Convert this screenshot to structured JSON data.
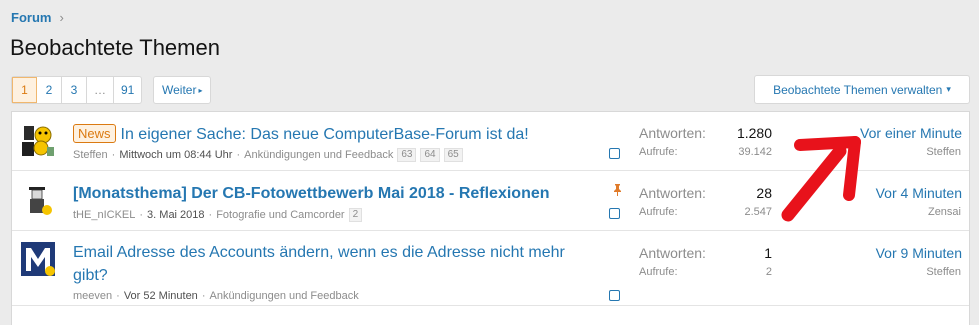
{
  "breadcrumb": {
    "label": "Forum",
    "separator": "›"
  },
  "page_title": "Beobachtete Themen",
  "pagination": {
    "pages": [
      "1",
      "2",
      "3",
      "…",
      "91"
    ],
    "current": "1",
    "next_label": "Weiter",
    "next_icon": "▸"
  },
  "manage_button": {
    "label": "Beobachtete Themen verwalten",
    "icon": "▾"
  },
  "threads": [
    {
      "badge": "News",
      "title": "In eigener Sache: Das neue ComputerBase-Forum ist da!",
      "author": "Steffen",
      "date": "Mittwoch um 08:44 Uhr",
      "forum": "Ankündigungen und Feedback",
      "pages": [
        "63",
        "64",
        "65"
      ],
      "replies_label": "Antworten:",
      "replies": "1.280",
      "views_label": "Aufrufe:",
      "views": "39.142",
      "last_time": "Vor einer Minute",
      "last_user": "Steffen"
    },
    {
      "title": "[Monatsthema] Der CB-Fotowettbewerb Mai 2018 - Reflexionen",
      "author": "tHE_nICKEL",
      "date": "3. Mai 2018",
      "forum": "Fotografie und Camcorder",
      "pages": [
        "2"
      ],
      "replies_label": "Antworten:",
      "replies": "28",
      "views_label": "Aufrufe:",
      "views": "2.547",
      "last_time": "Vor 4 Minuten",
      "last_user": "Zensai"
    },
    {
      "title_line1": "Email Adresse des Accounts ändern, wenn es die Adresse nicht mehr",
      "title_line2": "gibt?",
      "author": "meeven",
      "date": "Vor 52 Minuten",
      "forum": "Ankündigungen und Feedback",
      "replies_label": "Antworten:",
      "replies": "1",
      "views_label": "Aufrufe:",
      "views": "2",
      "last_time": "Vor 9 Minuten",
      "last_user": "Steffen"
    }
  ],
  "colors": {
    "link": "#2577b1",
    "accent": "#db7a11",
    "annotation_arrow": "#e8121b"
  }
}
